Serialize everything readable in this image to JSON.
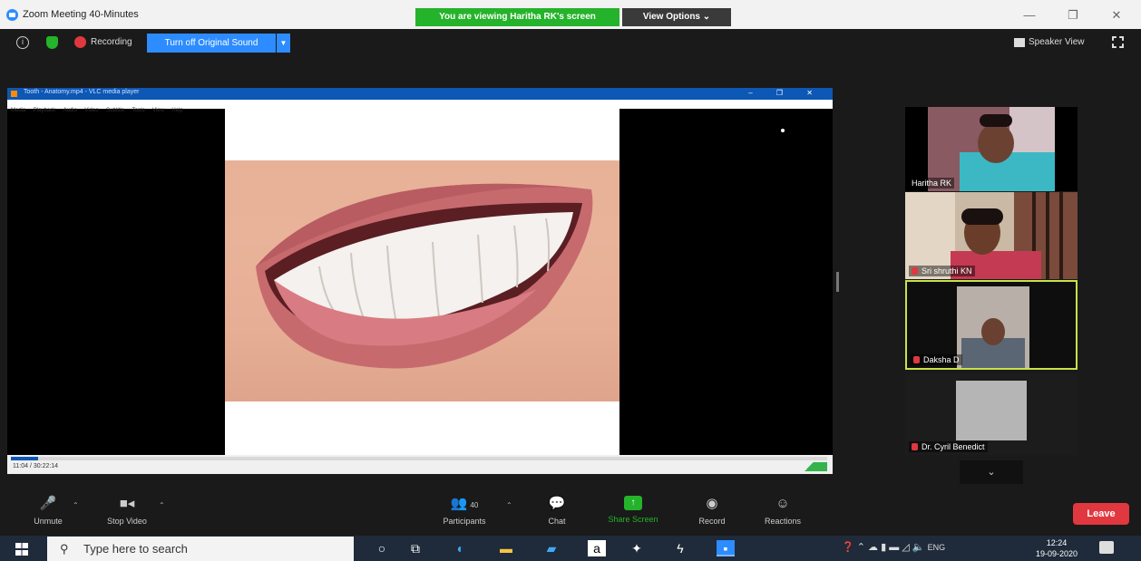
{
  "window": {
    "title": "Zoom Meeting 40-Minutes",
    "view_banner": "You are viewing Haritha RK's screen",
    "view_options": "View Options ⌄",
    "controls": [
      "—",
      "❐",
      "✕"
    ]
  },
  "meeting_bar": {
    "recording_label": "Recording",
    "original_sound_button": "Turn off Original Sound",
    "speaker_view": "Speaker View"
  },
  "shared_screen": {
    "player_title": "Tooth - Anatomy.mp4 - VLC media player",
    "player_menu": [
      "Media",
      "Playback",
      "Audio",
      "Video",
      "Subtitle",
      "Tools",
      "View",
      "Help"
    ],
    "player_time": "11:04 / 30:22:14"
  },
  "participants": [
    {
      "name": "Haritha RK",
      "muted": false
    },
    {
      "name": "Sri shruthi KN",
      "muted": true
    },
    {
      "name": "Daksha D",
      "muted": true
    },
    {
      "name": "Dr. Cyril Benedict",
      "muted": true
    }
  ],
  "toolbar": {
    "unmute": "Unmute",
    "stop_video": "Stop Video",
    "participants": "Participants",
    "participants_count": "40",
    "chat": "Chat",
    "share_screen": "Share Screen",
    "record": "Record",
    "reactions": "Reactions",
    "leave": "Leave"
  },
  "taskbar": {
    "search_placeholder": "Type here to search",
    "language": "ENG",
    "time": "12:24",
    "date": "19-09-2020"
  },
  "colors": {
    "zoom_blue": "#2d8cff",
    "banner_green": "#24b32a",
    "leave_red": "#e0383e",
    "active_speaker": "#c6e34a"
  }
}
